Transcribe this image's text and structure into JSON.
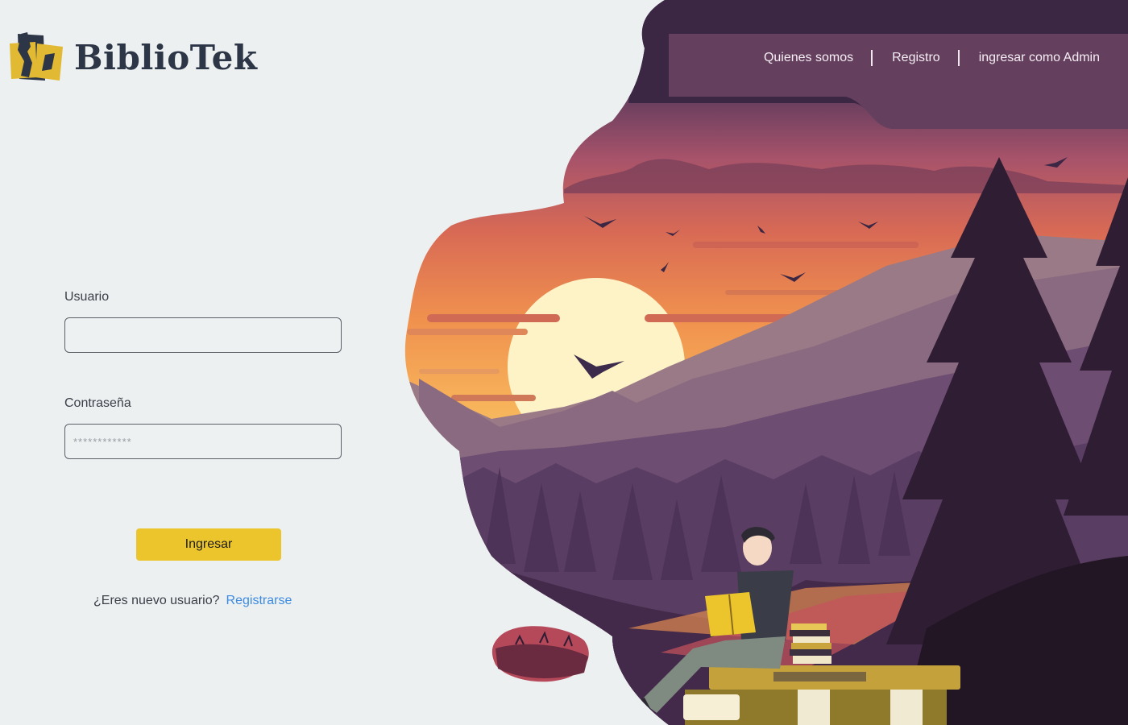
{
  "brand": {
    "name": "BiblioTek",
    "logo_icon": "book-logo-icon"
  },
  "nav": {
    "items": [
      {
        "label": "Quienes somos"
      },
      {
        "label": "Registro"
      },
      {
        "label": "ingresar como Admin"
      }
    ]
  },
  "login": {
    "username_label": "Usuario",
    "username_value": "",
    "password_label": "Contraseña",
    "password_placeholder": "************",
    "submit_label": "Ingresar",
    "signup_prompt": "¿Eres nuevo usuario?",
    "signup_link": "Registrarse"
  },
  "colors": {
    "background": "#ecf0f1",
    "accent": "#ecc52c",
    "link": "#3d8be0",
    "text": "#2c3340"
  }
}
